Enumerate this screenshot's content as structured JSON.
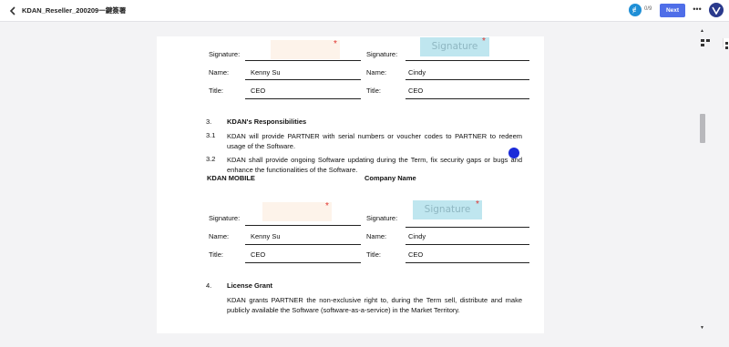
{
  "header": {
    "title": "KDAN_Reseller_200209一鍵簽署",
    "progress": "0/9",
    "next_label": "Next",
    "more_glyph": "•••"
  },
  "colors": {
    "accent": "#4f6ee8",
    "required": "#e0332f",
    "signature_fill": "#bfe6ef",
    "empty_field": "#fdf3ea"
  },
  "sig_block_1": {
    "left": {
      "signature_label": "Signature:",
      "name_label": "Name:",
      "name_value": "Kenny Su",
      "title_label": "Title:",
      "title_value": "CEO"
    },
    "right": {
      "signature_label": "Signature:",
      "signature_text": "Signature",
      "name_label": "Name:",
      "name_value": "Cindy",
      "title_label": "Title:",
      "title_value": "CEO"
    }
  },
  "section3": {
    "number": "3.",
    "title": "KDAN's Responsibilities",
    "items": [
      {
        "number": "3.1",
        "text": "KDAN will provide PARTNER with serial numbers or voucher codes to PARTNER to redeem usage of the Software."
      },
      {
        "number": "3.2",
        "text": "KDAN shall provide ongoing Software updating during the Term, fix security gaps or bugs and enhance the functionalities of the Software."
      }
    ]
  },
  "parties": {
    "left": "KDAN MOBILE",
    "right": "Company Name"
  },
  "sig_block_2": {
    "left": {
      "signature_label": "Signature:",
      "name_label": "Name:",
      "name_value": "Kenny Su",
      "title_label": "Title:",
      "title_value": "CEO"
    },
    "right": {
      "signature_label": "Signature:",
      "signature_text": "Signature",
      "name_label": "Name:",
      "name_value": "Cindy",
      "title_label": "Title:",
      "title_value": "CEO"
    }
  },
  "section4": {
    "number": "4.",
    "title": "License Grant",
    "text": "KDAN grants PARTNER the non-exclusive right to, during the Term sell, distribute and make publicly available the Software (software-as-a-service) in the Market Territory."
  },
  "required_mark": "*",
  "icons": [
    "back-icon",
    "kdan-progress-icon",
    "more-icon",
    "app-logo-icon",
    "panel-icon"
  ]
}
